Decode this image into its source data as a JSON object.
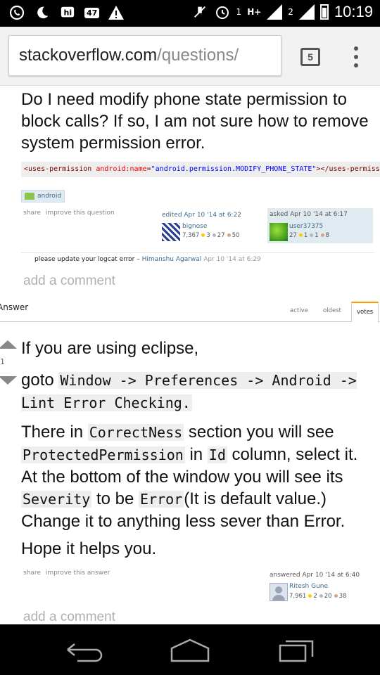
{
  "status_bar": {
    "time": "10:19",
    "notification_badge": "47",
    "sim1_label": "1",
    "network_type": "H+",
    "sim2_label": "2"
  },
  "browser": {
    "url_host": "stackoverflow.com",
    "url_path": "/questions/",
    "tab_count": "5"
  },
  "question": {
    "text_tail": "Do I need modify phone state permission to block calls? If so, I am not sure how to remove system permission error.",
    "code": {
      "open": "<uses-permission ",
      "attr": "android:name",
      "eq": "=",
      "value": "\"android.permission.MODIFY_PHONE_STATE\"",
      "close": "></uses-permiss"
    },
    "tag": "android",
    "menu": {
      "share": "share",
      "improve": "improve this question"
    },
    "editor": {
      "action": "edited Apr 10 '14 at 6:22",
      "name": "bignose",
      "rep": "7,367",
      "gold": "3",
      "silver": "27",
      "bronze": "50"
    },
    "owner": {
      "action": "asked Apr 10 '14 at 6:17",
      "name": "user37375",
      "rep": "27",
      "gold": "1",
      "silver": "1",
      "bronze": "8"
    },
    "comment": {
      "text": "please update your logcat error –",
      "user": "Himanshu Agarwal",
      "date": "Apr 10 '14 at 6:29"
    },
    "add_comment": "add a comment"
  },
  "answers": {
    "header": "Answer",
    "tabs": [
      "active",
      "oldest",
      "votes"
    ],
    "selected_tab": "votes"
  },
  "answer": {
    "score": "1",
    "p1": "If you are using eclipse,",
    "p2_pre": "goto ",
    "p2_code": "Window -> Preferences -> Android -> Lint Error Checking.",
    "p3": {
      "t1": "There in ",
      "c1": "CorrectNess",
      "t2": " section you will see ",
      "c2": "ProtectedPermission",
      "t3": " in ",
      "c3": "Id",
      "t4": " column, select it. At the bottom of the window you will see its ",
      "c4": "Severity",
      "t5": " to be ",
      "c5": "Error",
      "t6": "(It is default value.) Change it to anything less sever than Error."
    },
    "p4": "Hope it helps you.",
    "menu": {
      "share": "share",
      "improve": "improve this answer"
    },
    "author": {
      "action": "answered Apr 10 '14 at 6:40",
      "name": "Ritesh Gune",
      "rep": "7,961",
      "gold": "2",
      "silver": "20",
      "bronze": "38"
    },
    "add_comment": "add a comment"
  },
  "colors": {
    "link": "#3e6d8e",
    "tag_bg": "#e0eaf1",
    "active_tab_accent": "#ff9900",
    "gold": "#ffcc01",
    "silver": "#b4b8bc",
    "bronze": "#d1a684"
  },
  "icons": [
    "whatsapp-icon",
    "moon-icon",
    "hike-icon",
    "warning-icon",
    "mute-icon",
    "alarm-icon",
    "signal-icon",
    "battery-icon",
    "tabs-icon",
    "overflow-menu-icon",
    "back-icon",
    "home-icon",
    "recents-icon"
  ]
}
